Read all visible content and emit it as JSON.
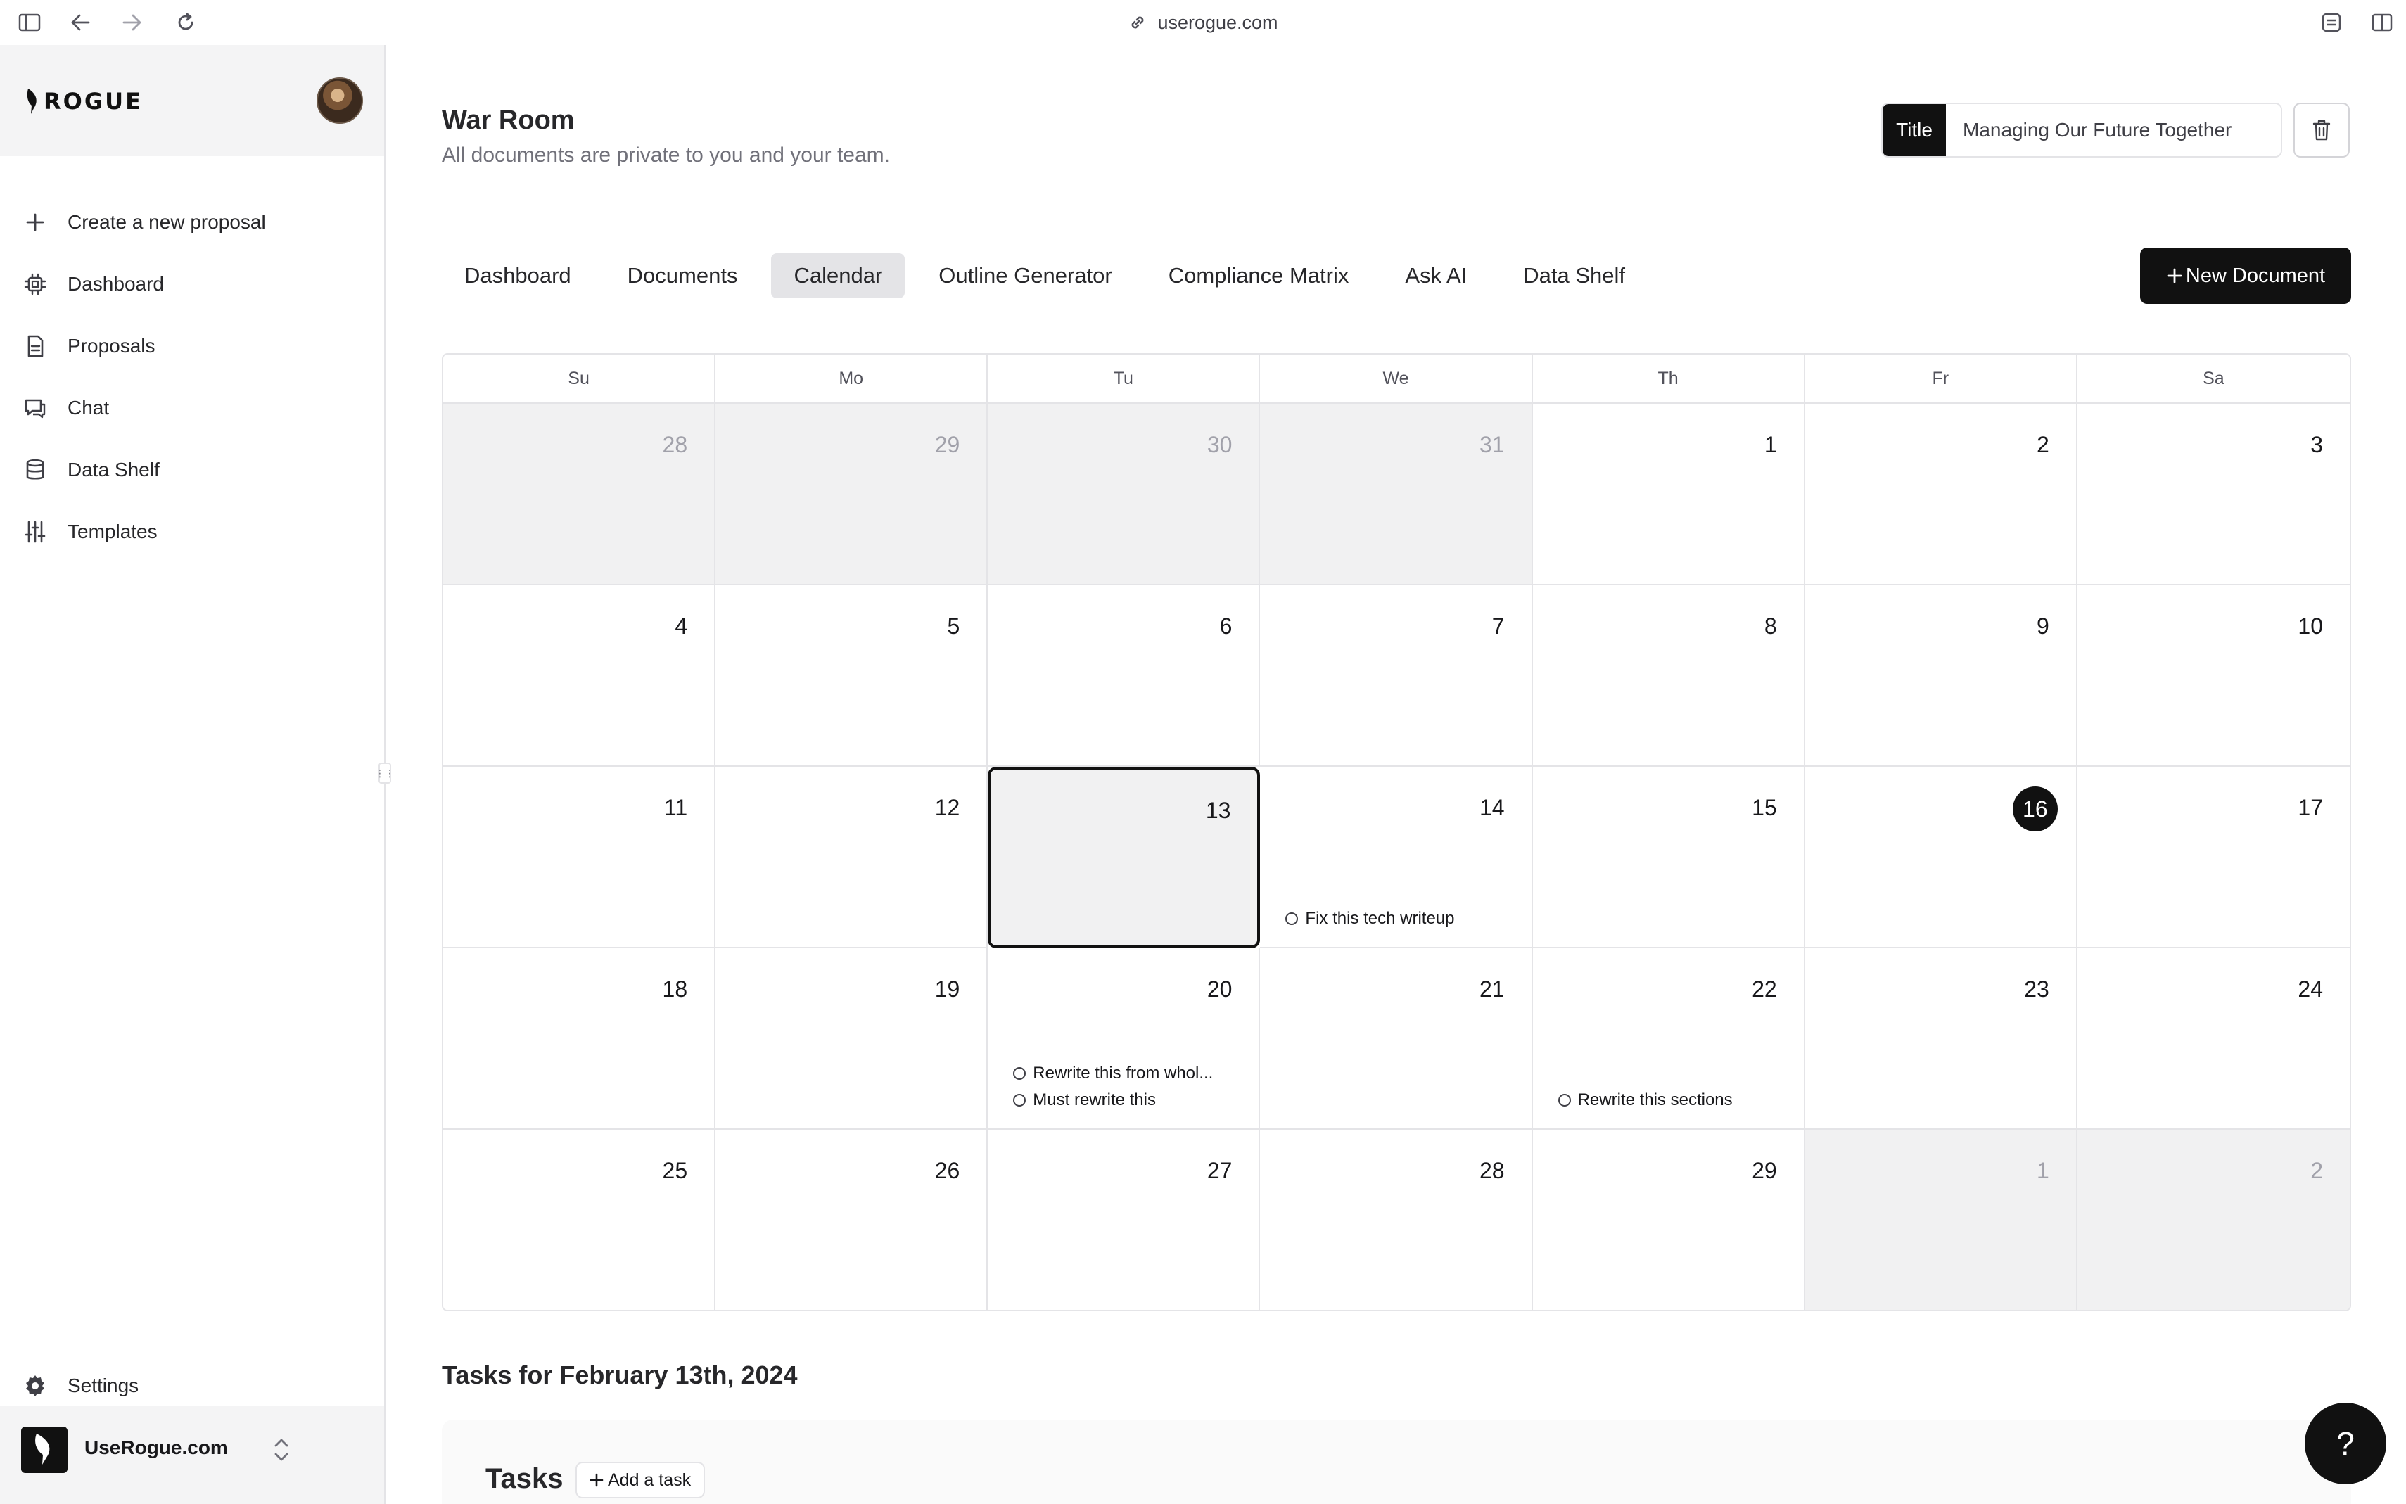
{
  "browser": {
    "url": "userogue.com"
  },
  "sidebar": {
    "logo_text": "ROGUE",
    "items": [
      {
        "label": "Create a new proposal",
        "icon": "plus-icon"
      },
      {
        "label": "Dashboard",
        "icon": "chip-icon"
      },
      {
        "label": "Proposals",
        "icon": "file-icon"
      },
      {
        "label": "Chat",
        "icon": "chat-icon"
      },
      {
        "label": "Data Shelf",
        "icon": "database-icon"
      },
      {
        "label": "Templates",
        "icon": "sliders-icon"
      }
    ],
    "settings_label": "Settings",
    "org_name": "UseRogue.com"
  },
  "header": {
    "title": "War Room",
    "subtitle": "All documents are private to you and your team.",
    "title_field_label": "Title",
    "title_field_value": "Managing Our Future Together"
  },
  "tabs": [
    {
      "label": "Dashboard",
      "active": false
    },
    {
      "label": "Documents",
      "active": false
    },
    {
      "label": "Calendar",
      "active": true
    },
    {
      "label": "Outline Generator",
      "active": false
    },
    {
      "label": "Compliance Matrix",
      "active": false
    },
    {
      "label": "Ask AI",
      "active": false
    },
    {
      "label": "Data Shelf",
      "active": false
    }
  ],
  "new_document_label": "New Document",
  "calendar": {
    "weekdays": [
      "Su",
      "Mo",
      "Tu",
      "We",
      "Th",
      "Fr",
      "Sa"
    ],
    "days": [
      {
        "day": "28",
        "outside": true
      },
      {
        "day": "29",
        "outside": true
      },
      {
        "day": "30",
        "outside": true
      },
      {
        "day": "31",
        "outside": true
      },
      {
        "day": "1"
      },
      {
        "day": "2"
      },
      {
        "day": "3"
      },
      {
        "day": "4"
      },
      {
        "day": "5"
      },
      {
        "day": "6"
      },
      {
        "day": "7"
      },
      {
        "day": "8"
      },
      {
        "day": "9"
      },
      {
        "day": "10"
      },
      {
        "day": "11"
      },
      {
        "day": "12"
      },
      {
        "day": "13",
        "selected": true
      },
      {
        "day": "14",
        "tasks": [
          "Fix this tech writeup"
        ]
      },
      {
        "day": "15"
      },
      {
        "day": "16",
        "today": true
      },
      {
        "day": "17"
      },
      {
        "day": "18"
      },
      {
        "day": "19"
      },
      {
        "day": "20",
        "tasks": [
          "Rewrite this from whol...",
          "Must rewrite this"
        ]
      },
      {
        "day": "21"
      },
      {
        "day": "22",
        "tasks": [
          "Rewrite this sections"
        ]
      },
      {
        "day": "23"
      },
      {
        "day": "24"
      },
      {
        "day": "25"
      },
      {
        "day": "26"
      },
      {
        "day": "27"
      },
      {
        "day": "28"
      },
      {
        "day": "29"
      },
      {
        "day": "1",
        "outside": true
      },
      {
        "day": "2",
        "outside": true
      }
    ]
  },
  "tasks_section": {
    "date_heading": "Tasks for February 13th, 2024",
    "title": "Tasks",
    "add_task_label": "Add a task"
  },
  "help_label": "?"
}
